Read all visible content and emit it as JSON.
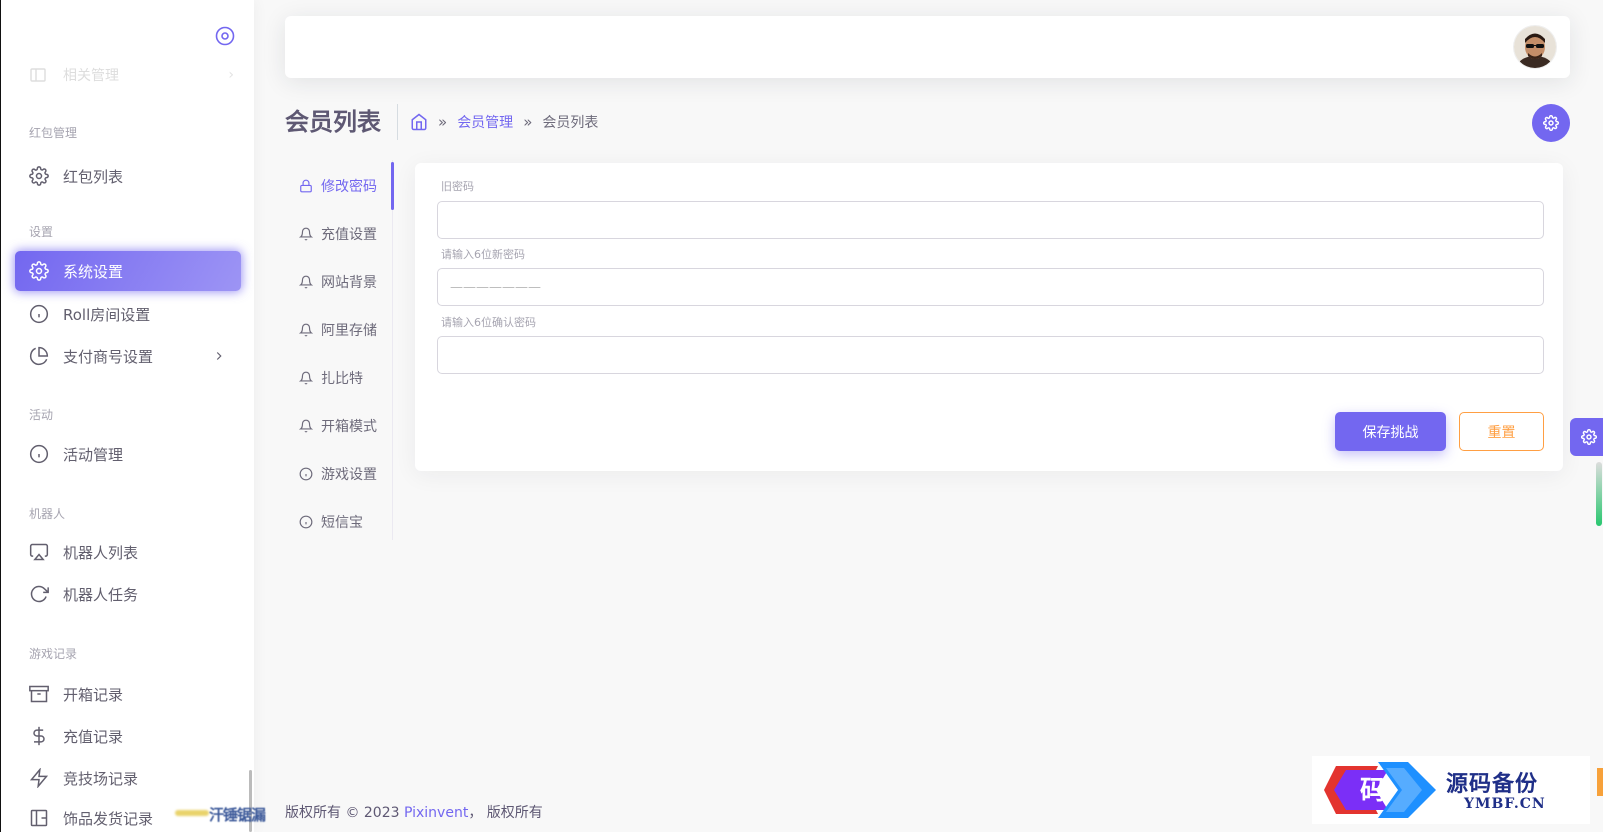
{
  "sidebar": {
    "faded_item_label": "相关管理",
    "sections": [
      {
        "header": "红包管理"
      },
      {
        "header": "设置"
      },
      {
        "header": "活动"
      },
      {
        "header": "机器人"
      },
      {
        "header": "游戏记录"
      }
    ],
    "items": {
      "redpacket_list": "红包列表",
      "system_settings": "系统设置",
      "roll_room": "Roll房间设置",
      "payment_account": "支付商号设置",
      "activity_mgmt": "活动管理",
      "robot_list": "机器人列表",
      "robot_task": "机器人任务",
      "box_records": "开箱记录",
      "recharge_records": "充值记录",
      "arena_records": "竞技场记录",
      "item_ship_records": "饰品发货记录"
    }
  },
  "header": {
    "title": "会员列表",
    "breadcrumb": {
      "home_icon": "home-icon",
      "sep": "»",
      "parent": "会员管理",
      "current": "会员列表"
    }
  },
  "tabs": [
    {
      "label": "修改密码",
      "icon": "lock-icon",
      "active": true
    },
    {
      "label": "充值设置",
      "icon": "bell-icon"
    },
    {
      "label": "网站背景",
      "icon": "bell-icon"
    },
    {
      "label": "阿里存储",
      "icon": "bell-icon"
    },
    {
      "label": "扎比特",
      "icon": "bell-icon"
    },
    {
      "label": "开箱模式",
      "icon": "bell-icon"
    },
    {
      "label": "游戏设置",
      "icon": "info-icon"
    },
    {
      "label": "短信宝",
      "icon": "info-icon"
    }
  ],
  "form": {
    "old_password_label": "旧密码",
    "new_password_label": "请输入6位新密码",
    "new_password_value": "———————",
    "confirm_password_label": "请输入6位确认密码",
    "save_label": "保存挑战",
    "reset_label": "重置"
  },
  "footer": {
    "blurred_text": "汗锤锯漏",
    "prefix": "版权所有 © 2023 ",
    "brand": "Pixinvent",
    "suffix": "， 版权所有"
  },
  "watermark": {
    "zh": "源码备份",
    "en": "YMBF.CN",
    "glyph": "码"
  },
  "colors": {
    "primary": "#7367f0",
    "warning": "#ff9f43",
    "success": "#28c76f"
  }
}
